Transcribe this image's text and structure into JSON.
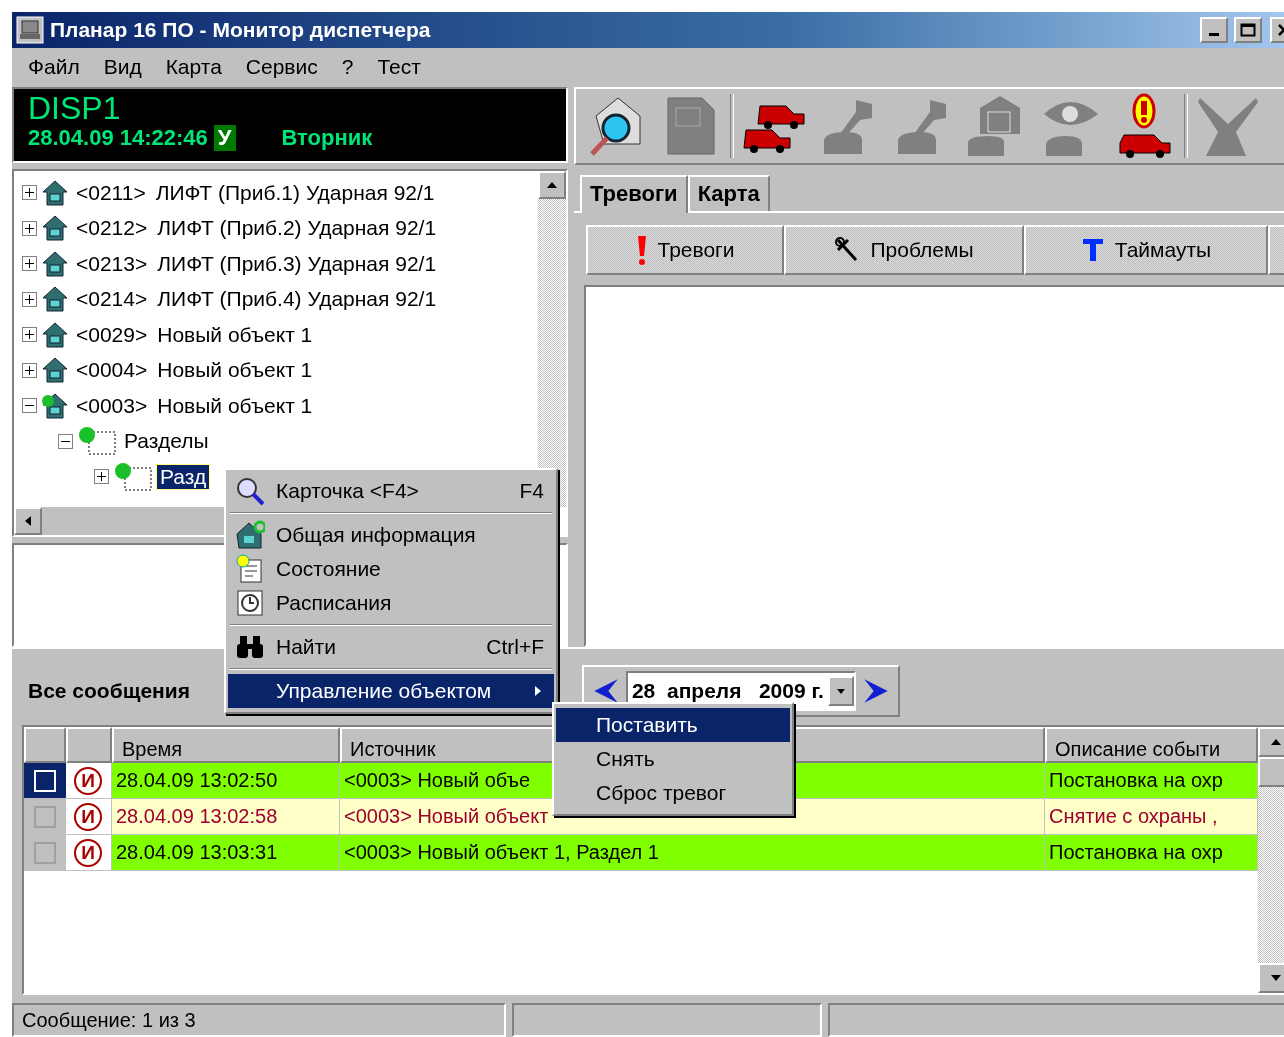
{
  "window": {
    "title": "Планар 16 ПО - Монитор диспетчера"
  },
  "menu_bar": [
    "Файл",
    "Вид",
    "Карта",
    "Сервис",
    "?",
    "Тест"
  ],
  "info_panel": {
    "station": "DISP1",
    "datetime": "28.04.09 14:22:46",
    "mode_badge": "У",
    "weekday": "Вторник"
  },
  "tree": [
    {
      "code": "<0211>",
      "label": "ЛИФТ (Приб.1) Ударная 92/1",
      "kind": "object",
      "expanded": false
    },
    {
      "code": "<0212>",
      "label": "ЛИФТ (Приб.2) Ударная 92/1",
      "kind": "object",
      "expanded": false
    },
    {
      "code": "<0213>",
      "label": "ЛИФТ (Приб.3) Ударная 92/1",
      "kind": "object",
      "expanded": false
    },
    {
      "code": "<0214>",
      "label": "ЛИФТ (Приб.4) Ударная 92/1",
      "kind": "object",
      "expanded": false
    },
    {
      "code": "<0029>",
      "label": "Новый объект 1",
      "kind": "object",
      "expanded": false
    },
    {
      "code": "<0004>",
      "label": "Новый объект 1",
      "kind": "object",
      "expanded": false
    },
    {
      "code": "<0003>",
      "label": "Новый объект 1",
      "kind": "object-armed",
      "expanded": true,
      "children": [
        {
          "label": "Разделы",
          "kind": "sections",
          "expanded": true,
          "children": [
            {
              "label": "Разд",
              "kind": "section",
              "expanded": false,
              "selected": true
            }
          ]
        }
      ]
    }
  ],
  "toolbar": [
    {
      "kind": "house-search",
      "disabled": false
    },
    {
      "kind": "document",
      "disabled": true
    },
    {
      "kind": "cars",
      "disabled": false
    },
    {
      "kind": "lever",
      "disabled": true
    },
    {
      "kind": "lever",
      "disabled": true
    },
    {
      "kind": "building",
      "disabled": true
    },
    {
      "kind": "eye",
      "disabled": true
    },
    {
      "kind": "alarm-car",
      "disabled": false
    },
    {
      "kind": "trigger",
      "disabled": true
    }
  ],
  "tabs": [
    {
      "label": "Тревоги",
      "selected": true
    },
    {
      "label": "Карта",
      "selected": false
    }
  ],
  "alert_tabs": [
    {
      "label": "Тревоги",
      "kind": "alarm"
    },
    {
      "label": "Проблемы",
      "kind": "pliers"
    },
    {
      "label": "Таймауты",
      "kind": "timeout"
    }
  ],
  "messages": {
    "title": "Все сообщения",
    "date": "28  апреля   2009 г.",
    "columns": [
      "Время",
      "Источник",
      "Описание событи"
    ],
    "rows": [
      {
        "selected": true,
        "kind": "arm",
        "badge": "И",
        "time": "28.04.09 13:02:50",
        "source": "<0003>  Новый объе",
        "description": "Постановка на охр"
      },
      {
        "selected": false,
        "kind": "disarm",
        "badge": "И",
        "time": "28.04.09 13:02:58",
        "source": "<0003>  Новый объект",
        "description": "Снятие с охраны , "
      },
      {
        "selected": false,
        "kind": "arm",
        "badge": "И",
        "time": "28.04.09 13:03:31",
        "source": "<0003>  Новый объект 1, Раздел 1",
        "description": "Постановка на охр"
      }
    ]
  },
  "context_menu": {
    "groups": [
      [
        {
          "label": "Карточка <F4>",
          "shortcut": "F4",
          "kind": "magnifier"
        }
      ],
      [
        {
          "label": "Общая информация",
          "kind": "house-info"
        },
        {
          "label": "Состояние",
          "kind": "state"
        },
        {
          "label": "Расписания",
          "kind": "clock"
        }
      ],
      [
        {
          "label": "Найти",
          "shortcut": "Ctrl+F",
          "kind": "binoculars"
        }
      ],
      [
        {
          "label": "Управление объектом",
          "kind": "none",
          "submenu": true,
          "selected": true
        }
      ]
    ],
    "submenu": [
      {
        "label": "Поставить",
        "selected": true
      },
      {
        "label": "Снять",
        "selected": false
      },
      {
        "label": "Сброс тревог",
        "selected": false
      }
    ]
  },
  "status_bar": [
    "Сообщение: 1 из 3"
  ]
}
